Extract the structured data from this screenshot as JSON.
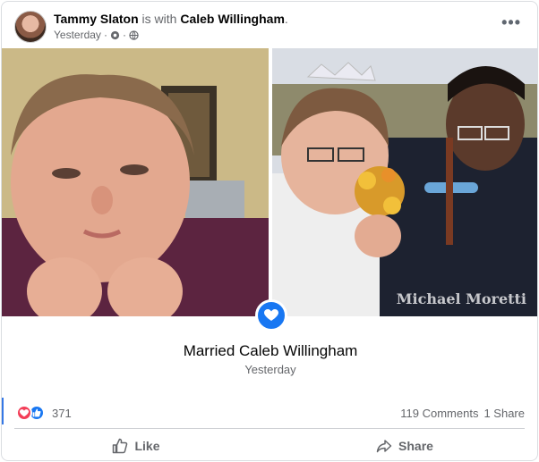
{
  "post": {
    "author": "Tammy Slaton",
    "with_text": "is with",
    "tagged": "Caleb Willingham",
    "period": ".",
    "timestamp": "Yesterday",
    "separator": "·",
    "more_label": "•••"
  },
  "photos": {
    "watermark": "Michael Moretti"
  },
  "event": {
    "icon": "heart-badge-icon",
    "title": "Married Caleb Willingham",
    "date": "Yesterday"
  },
  "engagement": {
    "reaction_count": "371",
    "comments": "119 Comments",
    "shares": "1 Share"
  },
  "actions": {
    "like_label": "Like",
    "share_label": "Share"
  },
  "colors": {
    "brand_blue": "#1877f2",
    "love_red": "#f33e58",
    "muted_text": "#65676b"
  }
}
